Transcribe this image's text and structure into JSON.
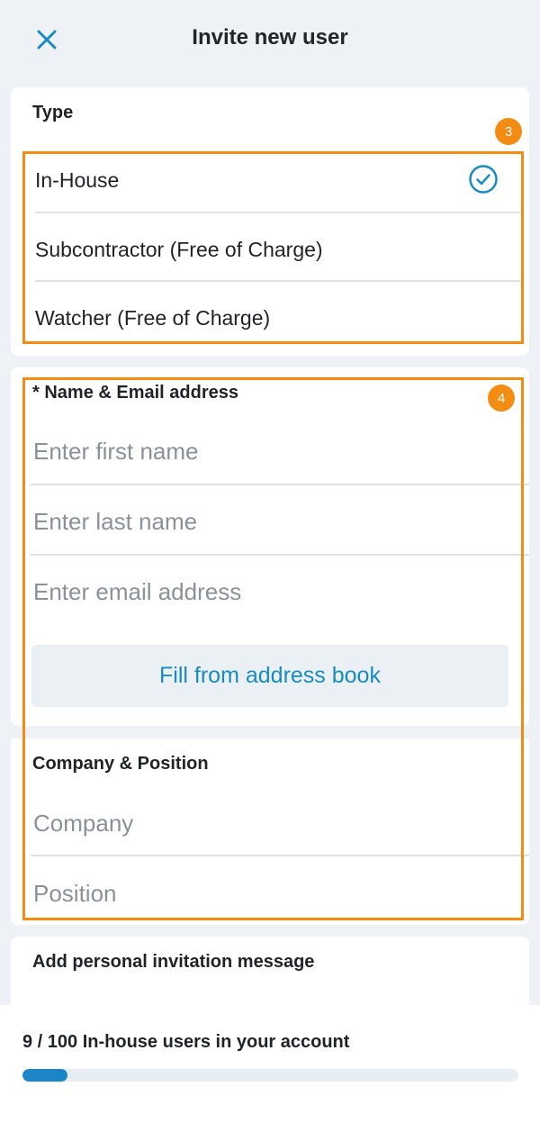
{
  "header": {
    "title": "Invite new user",
    "close_icon": "close-icon"
  },
  "type_section": {
    "label": "Type",
    "options": [
      {
        "label": "In-House",
        "selected": true
      },
      {
        "label": "Subcontractor (Free of Charge)",
        "selected": false
      },
      {
        "label": "Watcher (Free of Charge)",
        "selected": false
      }
    ],
    "check_icon": "check-circle-icon"
  },
  "name_section": {
    "label": "* Name & Email address",
    "first_name_placeholder": "Enter first name",
    "last_name_placeholder": "Enter last name",
    "email_placeholder": "Enter email address",
    "fill_button_label": "Fill from address book"
  },
  "company_section": {
    "label": "Company & Position",
    "company_placeholder": "Company",
    "position_placeholder": "Position"
  },
  "message_section": {
    "label": "Add personal invitation message"
  },
  "annotations": {
    "badge_3": "3",
    "badge_4": "4"
  },
  "usage": {
    "text": "9 / 100 In-house users in your account",
    "progress_fraction": 0.09
  },
  "colors": {
    "accent": "#1a8bc0",
    "annotation": "#f28c13",
    "background": "#EEF2F7"
  }
}
